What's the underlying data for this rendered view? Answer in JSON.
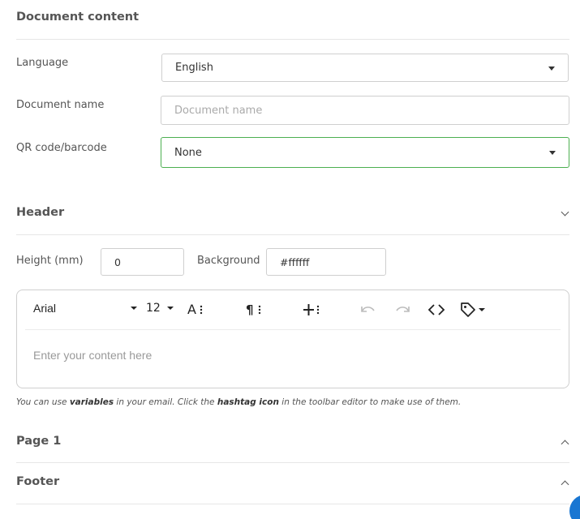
{
  "document_content": {
    "title": "Document content",
    "language": {
      "label": "Language",
      "value": "English"
    },
    "document_name": {
      "label": "Document name",
      "placeholder": "Document name"
    },
    "qr_code": {
      "label": "QR code/barcode",
      "value": "None"
    }
  },
  "header": {
    "title": "Header",
    "height": {
      "label": "Height (mm)",
      "value": "0"
    },
    "background": {
      "label": "Background",
      "value": "#ffffff"
    },
    "editor": {
      "font_family": "Arial",
      "font_size": "12",
      "placeholder": "Enter your content here",
      "icons": [
        "font-size-icon",
        "paragraph-icon",
        "insert-icon",
        "undo-icon",
        "redo-icon",
        "code-icon",
        "tag-icon"
      ]
    }
  },
  "hint": {
    "p1": "You can use ",
    "b1": "variables",
    "p2": " in your email. Click the ",
    "b2": "hashtag icon",
    "p3": " in the toolbar editor to make use of them."
  },
  "page1": {
    "title": "Page 1"
  },
  "footer": {
    "title": "Footer"
  },
  "colors": {
    "focus_border": "#4caf50",
    "fab": "#1976d2"
  }
}
